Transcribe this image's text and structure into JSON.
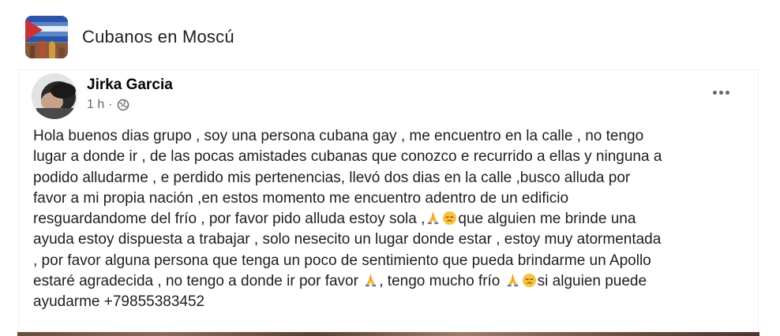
{
  "group": {
    "name": "Cubanos en Moscú"
  },
  "post": {
    "author": "Jirka Garcia",
    "time": "1 h",
    "separator": "·",
    "lines": [
      "Hola buenos dias grupo , soy una persona cubana gay , me encuentro en la calle , no tengo",
      "lugar a donde ir , de las pocas amistades cubanas que conozco e recurrido a ellas y ninguna a",
      "podido alludarme , e perdido mis pertenencias, llevó dos dias en la calle ,busco alluda por",
      "favor a mi propia nación ,en estos momento me encuentro adentro de un edificio",
      "resguardandome del frío , por favor pido alluda estoy sola ,",
      "que alguien me brinde una",
      "ayuda estoy dispuesta a trabajar , solo nesecito un lugar donde estar , estoy muy atormentada",
      ", por favor alguna persona que tenga un poco de sentimiento que pueda brindarme un Apollo",
      "estaré agradecida , no tengo a donde ir por favor",
      ", tengo mucho frío",
      "si alguien puede",
      "ayudarme  +79855383452"
    ]
  },
  "icons": {
    "globe": "globe-icon",
    "more": "more-options-icon",
    "pray": "folded-hands-emoji",
    "sad": "pensive-face-emoji"
  },
  "colors": {
    "meta": "#65676b",
    "text": "#1c1e21",
    "emoji_yellow": "#f7c23c"
  }
}
